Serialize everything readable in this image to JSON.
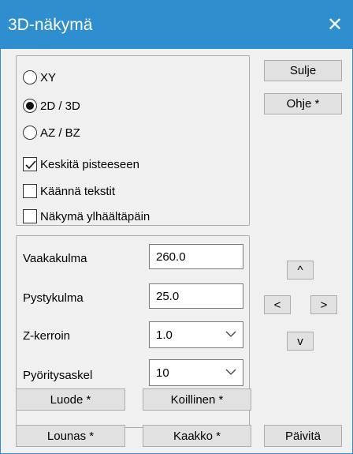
{
  "window": {
    "title": "3D-näkymä",
    "close_glyph": "✕"
  },
  "view_options": {
    "radio_xy": "XY",
    "radio_2d3d": "2D / 3D",
    "radio_azbz": "AZ / BZ",
    "selected": "2D / 3D",
    "check_center": "Keskitä pisteeseen",
    "check_center_checked": true,
    "check_rotate_text": "Käännä tekstit",
    "check_rotate_text_checked": false,
    "check_top_view": "Näkymä ylhäältäpäin",
    "check_top_view_checked": false
  },
  "side_buttons": {
    "close": "Sulje",
    "help": "Ohje *"
  },
  "angles": {
    "horizontal_label": "Vaakakulma",
    "horizontal_value": "260.0",
    "vertical_label": "Pystykulma",
    "vertical_value": "25.0",
    "z_factor_label": "Z-kerroin",
    "z_factor_value": "1.0",
    "step_label": "Pyöritysaskel",
    "step_value": "10"
  },
  "arrows": {
    "up": "^",
    "left": "<",
    "right": ">",
    "down": "v"
  },
  "bottom_buttons": {
    "northwest": "Luode *",
    "northeast": "Koillinen *",
    "southwest": "Lounas *",
    "southeast": "Kaakko *",
    "refresh": "Päivitä"
  },
  "colors": {
    "titlebar": "#2e8ece",
    "button_face": "#e1e1e1"
  }
}
